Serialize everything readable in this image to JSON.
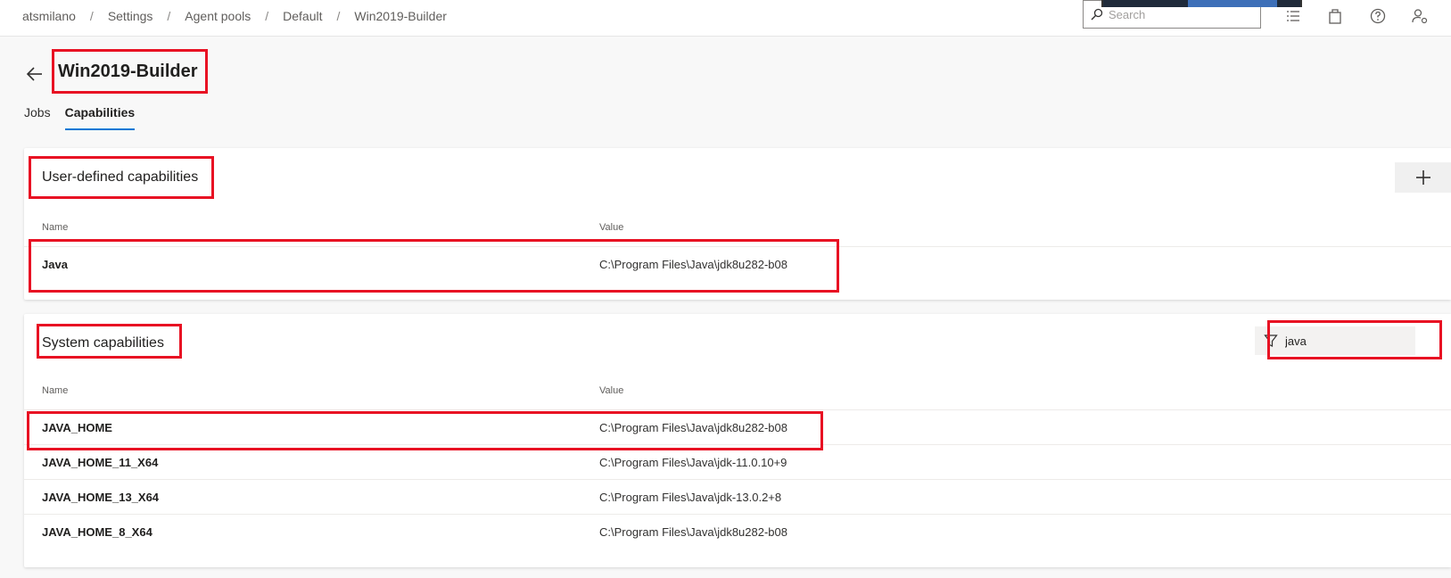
{
  "breadcrumb": [
    "atsmilano",
    "Settings",
    "Agent pools",
    "Default",
    "Win2019-Builder"
  ],
  "search": {
    "placeholder": "Search"
  },
  "header": {
    "title": "Win2019-Builder"
  },
  "tabs": [
    {
      "label": "Jobs",
      "active": false
    },
    {
      "label": "Capabilities",
      "active": true
    }
  ],
  "user_defined": {
    "title": "User-defined capabilities",
    "col_name": "Name",
    "col_value": "Value",
    "rows": [
      {
        "name": "Java",
        "value": "C:\\Program Files\\Java\\jdk8u282-b08"
      }
    ]
  },
  "system": {
    "title": "System capabilities",
    "filter_value": "java",
    "col_name": "Name",
    "col_value": "Value",
    "rows": [
      {
        "name": "JAVA_HOME",
        "value": "C:\\Program Files\\Java\\jdk8u282-b08"
      },
      {
        "name": "JAVA_HOME_11_X64",
        "value": "C:\\Program Files\\Java\\jdk-11.0.10+9"
      },
      {
        "name": "JAVA_HOME_13_X64",
        "value": "C:\\Program Files\\Java\\jdk-13.0.2+8"
      },
      {
        "name": "JAVA_HOME_8_X64",
        "value": "C:\\Program Files\\Java\\jdk8u282-b08"
      }
    ]
  },
  "colors": {
    "accent": "#0078d4",
    "highlight": "#e81123"
  },
  "icons": [
    "search-icon",
    "list-icon",
    "bag-icon",
    "help-icon",
    "user-settings-icon",
    "back-arrow-icon",
    "plus-icon",
    "filter-icon"
  ]
}
